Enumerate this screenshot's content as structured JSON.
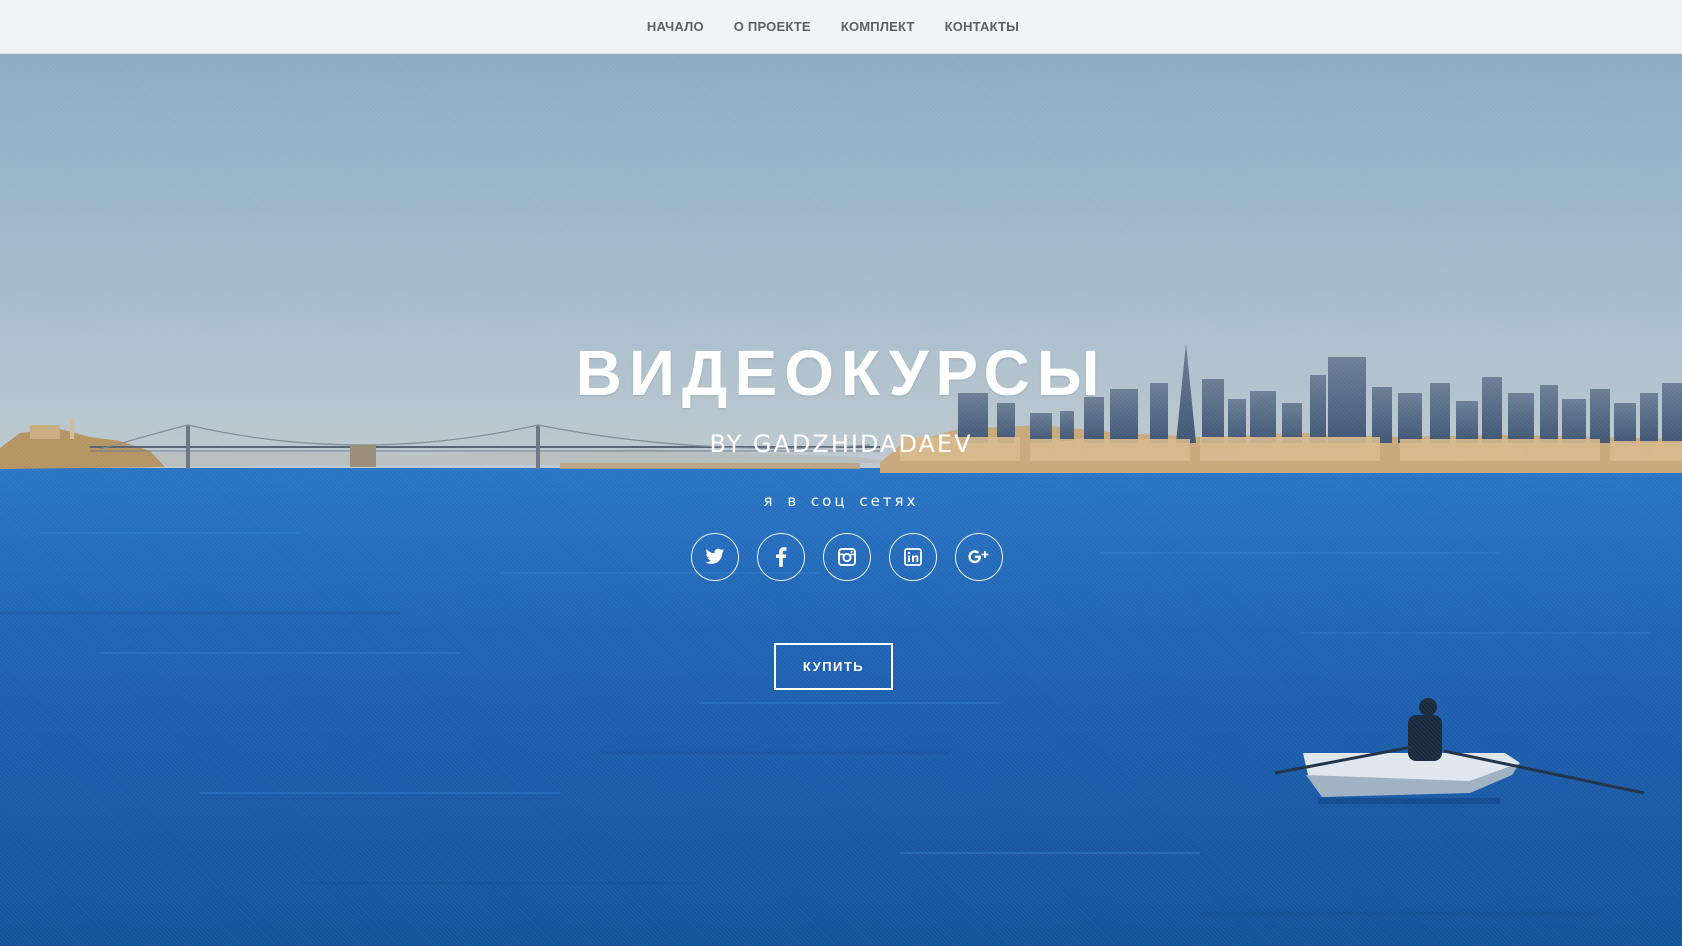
{
  "nav": {
    "items": [
      {
        "label": "НАЧАЛО"
      },
      {
        "label": "О ПРОЕКТЕ"
      },
      {
        "label": "КОМПЛЕКТ"
      },
      {
        "label": "КОНТАКТЫ"
      }
    ]
  },
  "hero": {
    "title": "ВИДЕОКУРСЫ",
    "subtitle": "BY GADZHIDADAEV",
    "social_label": "я в соц сетях",
    "socials": [
      {
        "icon": "twitter-icon"
      },
      {
        "icon": "facebook-icon"
      },
      {
        "icon": "instagram-icon"
      },
      {
        "icon": "linkedin-icon"
      },
      {
        "icon": "google-plus-icon"
      }
    ],
    "buy_label": "КУПИТЬ"
  },
  "colors": {
    "sky": "#9bb6c9",
    "water": "#1f5fae",
    "nav_bg": "#f1f3f5",
    "nav_text": "#5c6166",
    "text": "#ffffff"
  }
}
